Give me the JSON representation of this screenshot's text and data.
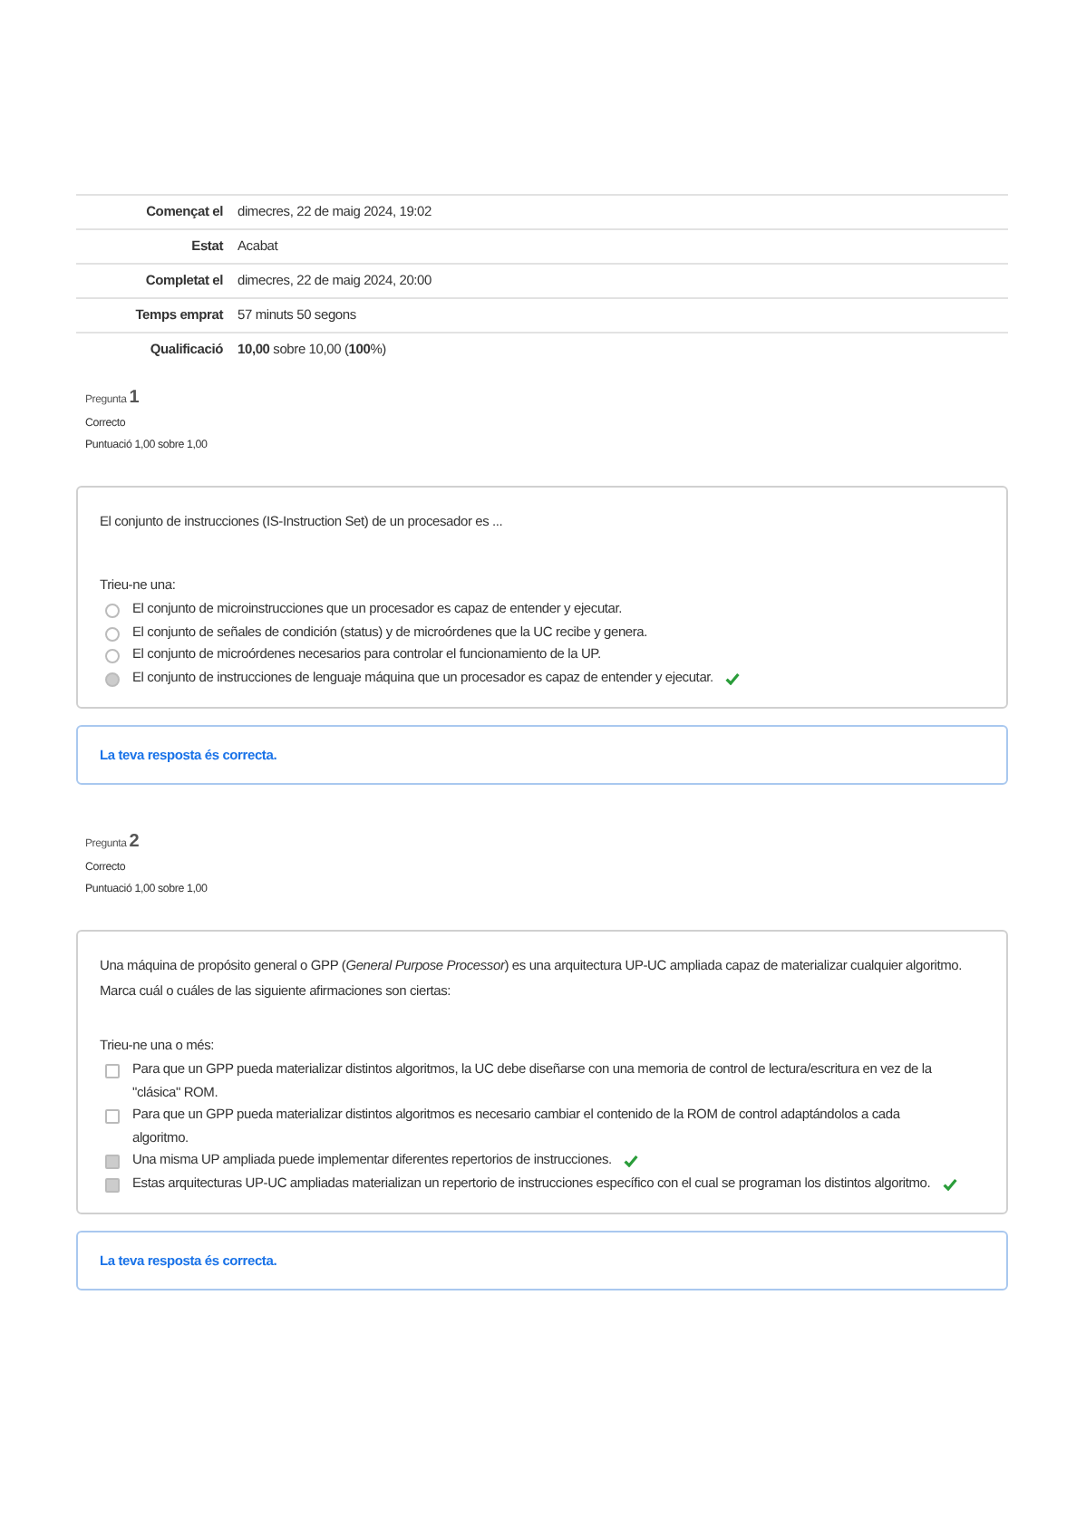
{
  "summary": [
    {
      "label": "Començat el",
      "value": "dimecres, 22 de maig 2024, 19:02"
    },
    {
      "label": "Estat",
      "value": "Acabat"
    },
    {
      "label": "Completat el",
      "value": "dimecres, 22 de maig 2024, 20:00"
    },
    {
      "label": "Temps emprat",
      "value": "57 minuts 50 segons"
    },
    {
      "label": "Qualificació",
      "value": "**10,00** sobre 10,00 (**100**%)"
    }
  ],
  "questions": [
    {
      "label": "Pregunta",
      "number": "1",
      "status": "Correcto",
      "score": "Puntuació 1,00 sobre 1,00",
      "kind": "radio",
      "text": "El conjunto de instrucciones (IS-Instruction Set) de un procesador es ...",
      "prompt": "Trieu-ne una:",
      "options": [
        {
          "text": "El conjunto de microinstrucciones que un procesador es capaz de entender y ejecutar.",
          "selected": false,
          "correct": false
        },
        {
          "text": "El conjunto de señales de condición (status) y de microórdenes que la UC recibe y genera.",
          "selected": false,
          "correct": false
        },
        {
          "text": "El conjunto de microórdenes necesarios para controlar el funcionamiento de la UP.",
          "selected": false,
          "correct": false
        },
        {
          "text": "El conjunto de instrucciones de lenguaje máquina que un procesador es capaz de entender y ejecutar.",
          "selected": true,
          "correct": true
        }
      ],
      "feedback": "La teva resposta és correcta."
    },
    {
      "label": "Pregunta",
      "number": "2",
      "status": "Correcto",
      "score": "Puntuació 1,00 sobre 1,00",
      "kind": "checkbox",
      "text": "Una máquina de propósito general o GPP (*General Purpose Processor*) es una arquitectura UP-UC ampliada capaz de materializar cualquier algoritmo. Marca cuál o cuáles de las siguiente afirmaciones son ciertas:",
      "prompt": "Trieu-ne una o més:",
      "options": [
        {
          "text": "Para que un GPP pueda materializar distintos algoritmos, la UC debe diseñarse con una memoria de control de lectura/escritura en vez de la \"clásica\" ROM.",
          "selected": false,
          "correct": false
        },
        {
          "text": "Para que un GPP pueda materializar distintos algoritmos es necesario cambiar el contenido de la ROM de control adaptándolos a cada algoritmo.",
          "selected": false,
          "correct": false
        },
        {
          "text": "Una misma UP ampliada puede implementar diferentes repertorios de instrucciones.",
          "selected": true,
          "correct": true
        },
        {
          "text": "Estas arquitecturas UP-UC ampliadas materializan un repertorio de instrucciones específico con el cual se programan los distintos algoritmo.",
          "selected": true,
          "correct": true
        }
      ],
      "feedback": "La teva resposta és correcta."
    }
  ]
}
